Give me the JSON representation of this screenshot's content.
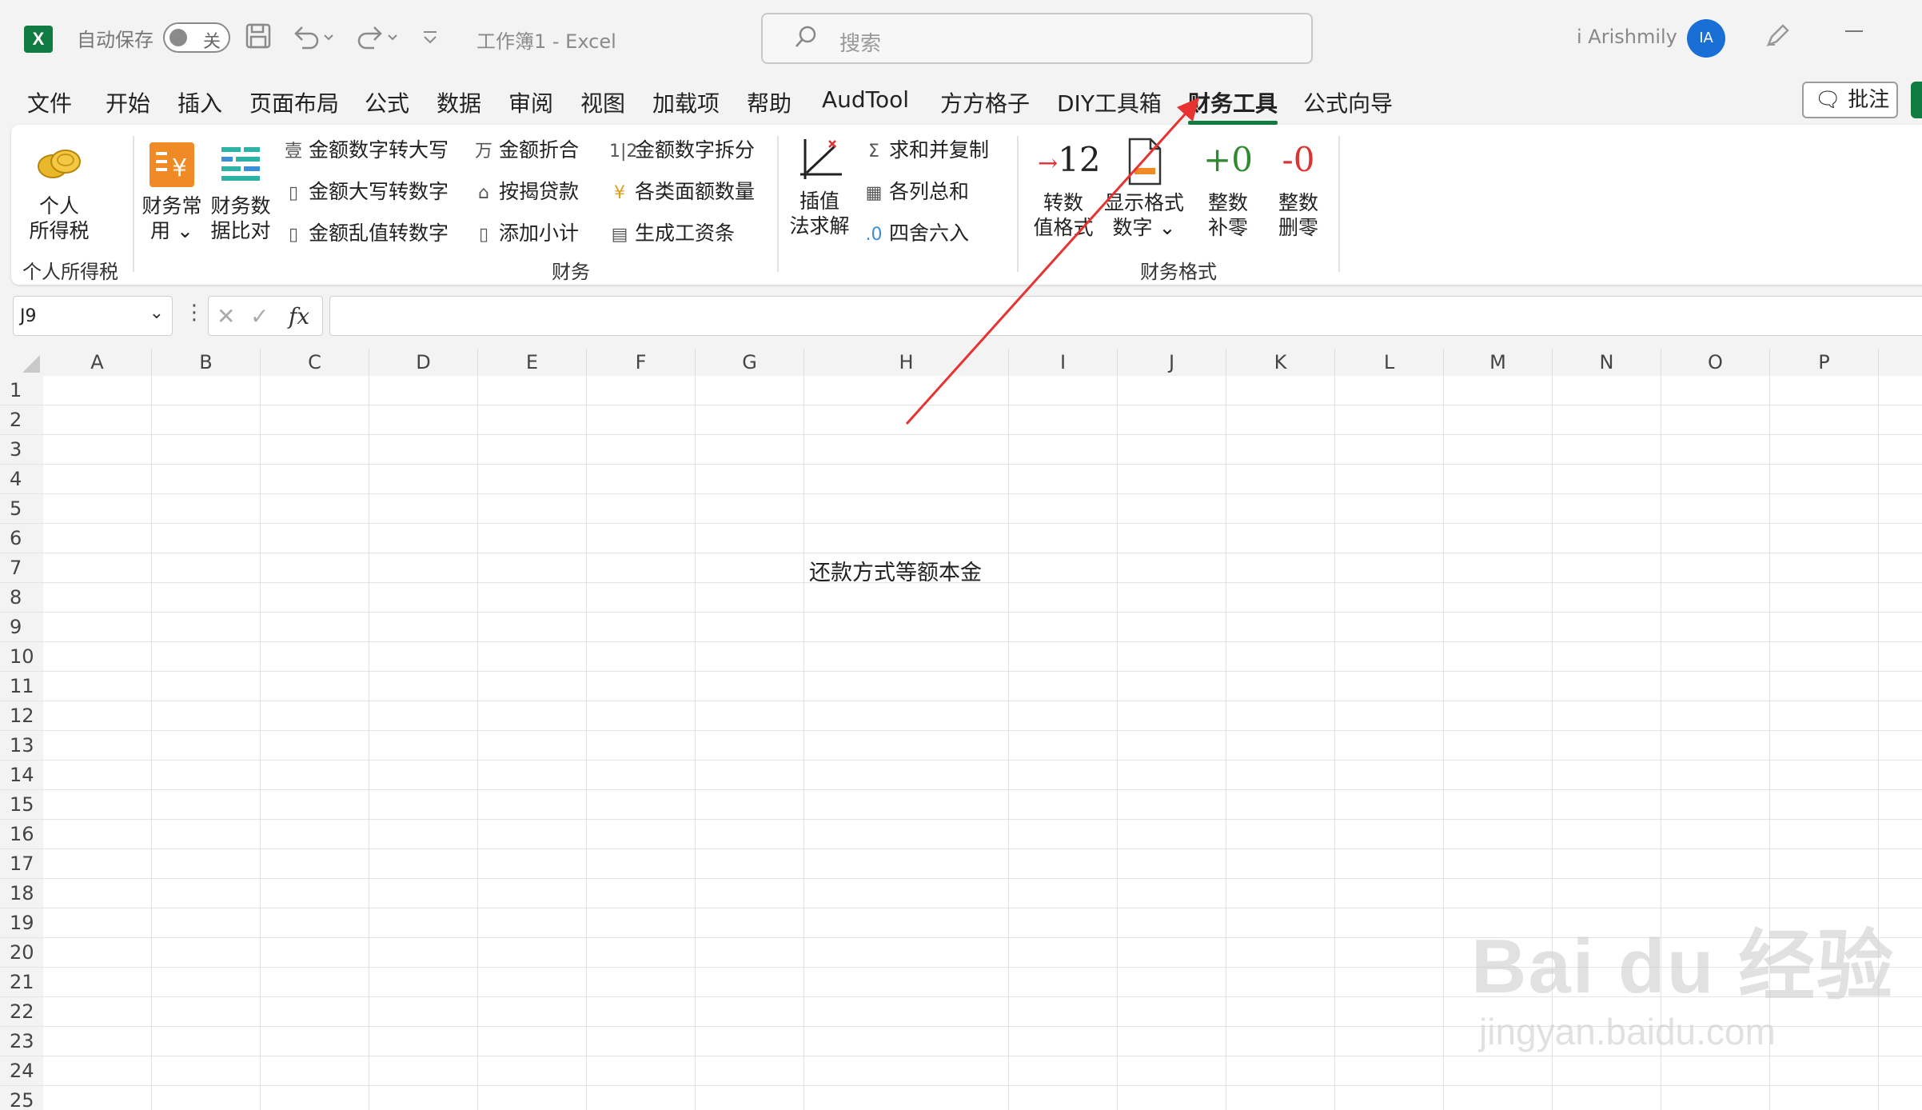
{
  "titlebar": {
    "autosave_label": "自动保存",
    "autosave_state": "关",
    "doc_title": "工作簿1  -  Excel",
    "search_placeholder": "搜索",
    "user_name": "i Arishmily",
    "avatar_initials": "IA"
  },
  "menu": {
    "tabs": [
      "文件",
      "开始",
      "插入",
      "页面布局",
      "公式",
      "数据",
      "审阅",
      "视图",
      "加载项",
      "帮助",
      "AudTool",
      "方方格子",
      "DIY工具箱",
      "财务工具",
      "公式向导"
    ],
    "active_tab": "财务工具",
    "comment_label": "批注"
  },
  "ribbon": {
    "personal_tax": {
      "btn_line1": "个人",
      "btn_line2": "所得税",
      "group_label": "个人所得税"
    },
    "finance": {
      "common_line1": "财务常",
      "common_line2": "用",
      "compare_line1": "财务数",
      "compare_line2": "据比对",
      "col1": [
        "金额数字转大写",
        "金额大写转数字",
        "金额乱值转数字"
      ],
      "col2": [
        "金额折合",
        "按揭贷款",
        "添加小计"
      ],
      "col3": [
        "金额数字拆分",
        "各类面额数量",
        "生成工资条"
      ],
      "interp_line1": "插值",
      "interp_line2": "法求解",
      "col4": [
        "求和并复制",
        "各列总和",
        "四舍六入"
      ],
      "group_label": "财务"
    },
    "format": {
      "btn1_line1": "转数",
      "btn1_line2": "值格式",
      "btn2_line1": "显示格式",
      "btn2_line2": "数字",
      "btn3_line1": "整数",
      "btn3_line2": "补零",
      "btn4_line1": "整数",
      "btn4_line2": "删零",
      "icon1_text": "12",
      "icon3_text": "+0",
      "icon4_text": "-0",
      "group_label": "财务格式"
    }
  },
  "formula_bar": {
    "name_box": "J9",
    "fx": "fx",
    "content": ""
  },
  "sheet": {
    "columns": [
      "A",
      "B",
      "C",
      "D",
      "E",
      "F",
      "G",
      "H",
      "I",
      "J",
      "K",
      "L",
      "M",
      "N",
      "O",
      "P"
    ],
    "rows": [
      "1",
      "2",
      "3",
      "4",
      "5",
      "6",
      "7",
      "8",
      "9",
      "10",
      "11",
      "12",
      "13",
      "14",
      "15",
      "16",
      "17",
      "18",
      "19",
      "20",
      "21",
      "22",
      "23",
      "24",
      "25"
    ],
    "cell_H7": "还款方式等额本金"
  },
  "watermark": {
    "line1": "Bai du 经验",
    "line2": "jingyan.baidu.com"
  },
  "colors": {
    "excel_green": "#107c41",
    "annotation_red": "#e8322f",
    "avatar_blue": "#1a6fd6"
  }
}
